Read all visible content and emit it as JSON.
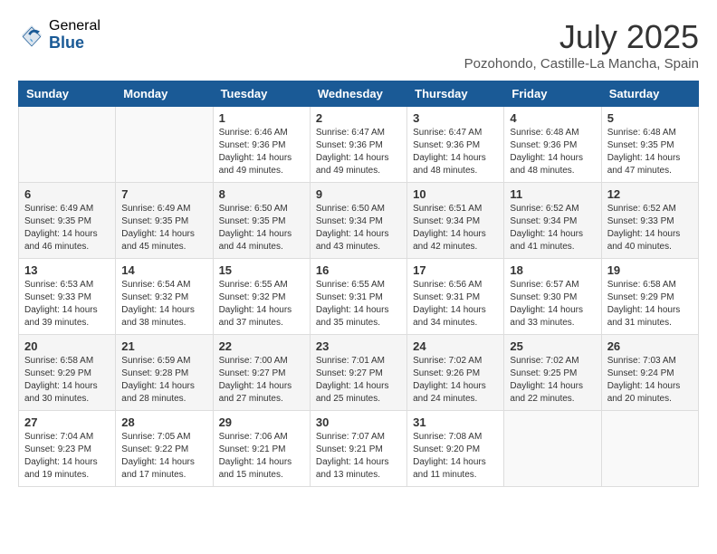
{
  "header": {
    "logo_general": "General",
    "logo_blue": "Blue",
    "month_title": "July 2025",
    "location": "Pozohondo, Castille-La Mancha, Spain"
  },
  "weekdays": [
    "Sunday",
    "Monday",
    "Tuesday",
    "Wednesday",
    "Thursday",
    "Friday",
    "Saturday"
  ],
  "weeks": [
    [
      {
        "day": "",
        "sunrise": "",
        "sunset": "",
        "daylight": ""
      },
      {
        "day": "",
        "sunrise": "",
        "sunset": "",
        "daylight": ""
      },
      {
        "day": "1",
        "sunrise": "Sunrise: 6:46 AM",
        "sunset": "Sunset: 9:36 PM",
        "daylight": "Daylight: 14 hours and 49 minutes."
      },
      {
        "day": "2",
        "sunrise": "Sunrise: 6:47 AM",
        "sunset": "Sunset: 9:36 PM",
        "daylight": "Daylight: 14 hours and 49 minutes."
      },
      {
        "day": "3",
        "sunrise": "Sunrise: 6:47 AM",
        "sunset": "Sunset: 9:36 PM",
        "daylight": "Daylight: 14 hours and 48 minutes."
      },
      {
        "day": "4",
        "sunrise": "Sunrise: 6:48 AM",
        "sunset": "Sunset: 9:36 PM",
        "daylight": "Daylight: 14 hours and 48 minutes."
      },
      {
        "day": "5",
        "sunrise": "Sunrise: 6:48 AM",
        "sunset": "Sunset: 9:35 PM",
        "daylight": "Daylight: 14 hours and 47 minutes."
      }
    ],
    [
      {
        "day": "6",
        "sunrise": "Sunrise: 6:49 AM",
        "sunset": "Sunset: 9:35 PM",
        "daylight": "Daylight: 14 hours and 46 minutes."
      },
      {
        "day": "7",
        "sunrise": "Sunrise: 6:49 AM",
        "sunset": "Sunset: 9:35 PM",
        "daylight": "Daylight: 14 hours and 45 minutes."
      },
      {
        "day": "8",
        "sunrise": "Sunrise: 6:50 AM",
        "sunset": "Sunset: 9:35 PM",
        "daylight": "Daylight: 14 hours and 44 minutes."
      },
      {
        "day": "9",
        "sunrise": "Sunrise: 6:50 AM",
        "sunset": "Sunset: 9:34 PM",
        "daylight": "Daylight: 14 hours and 43 minutes."
      },
      {
        "day": "10",
        "sunrise": "Sunrise: 6:51 AM",
        "sunset": "Sunset: 9:34 PM",
        "daylight": "Daylight: 14 hours and 42 minutes."
      },
      {
        "day": "11",
        "sunrise": "Sunrise: 6:52 AM",
        "sunset": "Sunset: 9:34 PM",
        "daylight": "Daylight: 14 hours and 41 minutes."
      },
      {
        "day": "12",
        "sunrise": "Sunrise: 6:52 AM",
        "sunset": "Sunset: 9:33 PM",
        "daylight": "Daylight: 14 hours and 40 minutes."
      }
    ],
    [
      {
        "day": "13",
        "sunrise": "Sunrise: 6:53 AM",
        "sunset": "Sunset: 9:33 PM",
        "daylight": "Daylight: 14 hours and 39 minutes."
      },
      {
        "day": "14",
        "sunrise": "Sunrise: 6:54 AM",
        "sunset": "Sunset: 9:32 PM",
        "daylight": "Daylight: 14 hours and 38 minutes."
      },
      {
        "day": "15",
        "sunrise": "Sunrise: 6:55 AM",
        "sunset": "Sunset: 9:32 PM",
        "daylight": "Daylight: 14 hours and 37 minutes."
      },
      {
        "day": "16",
        "sunrise": "Sunrise: 6:55 AM",
        "sunset": "Sunset: 9:31 PM",
        "daylight": "Daylight: 14 hours and 35 minutes."
      },
      {
        "day": "17",
        "sunrise": "Sunrise: 6:56 AM",
        "sunset": "Sunset: 9:31 PM",
        "daylight": "Daylight: 14 hours and 34 minutes."
      },
      {
        "day": "18",
        "sunrise": "Sunrise: 6:57 AM",
        "sunset": "Sunset: 9:30 PM",
        "daylight": "Daylight: 14 hours and 33 minutes."
      },
      {
        "day": "19",
        "sunrise": "Sunrise: 6:58 AM",
        "sunset": "Sunset: 9:29 PM",
        "daylight": "Daylight: 14 hours and 31 minutes."
      }
    ],
    [
      {
        "day": "20",
        "sunrise": "Sunrise: 6:58 AM",
        "sunset": "Sunset: 9:29 PM",
        "daylight": "Daylight: 14 hours and 30 minutes."
      },
      {
        "day": "21",
        "sunrise": "Sunrise: 6:59 AM",
        "sunset": "Sunset: 9:28 PM",
        "daylight": "Daylight: 14 hours and 28 minutes."
      },
      {
        "day": "22",
        "sunrise": "Sunrise: 7:00 AM",
        "sunset": "Sunset: 9:27 PM",
        "daylight": "Daylight: 14 hours and 27 minutes."
      },
      {
        "day": "23",
        "sunrise": "Sunrise: 7:01 AM",
        "sunset": "Sunset: 9:27 PM",
        "daylight": "Daylight: 14 hours and 25 minutes."
      },
      {
        "day": "24",
        "sunrise": "Sunrise: 7:02 AM",
        "sunset": "Sunset: 9:26 PM",
        "daylight": "Daylight: 14 hours and 24 minutes."
      },
      {
        "day": "25",
        "sunrise": "Sunrise: 7:02 AM",
        "sunset": "Sunset: 9:25 PM",
        "daylight": "Daylight: 14 hours and 22 minutes."
      },
      {
        "day": "26",
        "sunrise": "Sunrise: 7:03 AM",
        "sunset": "Sunset: 9:24 PM",
        "daylight": "Daylight: 14 hours and 20 minutes."
      }
    ],
    [
      {
        "day": "27",
        "sunrise": "Sunrise: 7:04 AM",
        "sunset": "Sunset: 9:23 PM",
        "daylight": "Daylight: 14 hours and 19 minutes."
      },
      {
        "day": "28",
        "sunrise": "Sunrise: 7:05 AM",
        "sunset": "Sunset: 9:22 PM",
        "daylight": "Daylight: 14 hours and 17 minutes."
      },
      {
        "day": "29",
        "sunrise": "Sunrise: 7:06 AM",
        "sunset": "Sunset: 9:21 PM",
        "daylight": "Daylight: 14 hours and 15 minutes."
      },
      {
        "day": "30",
        "sunrise": "Sunrise: 7:07 AM",
        "sunset": "Sunset: 9:21 PM",
        "daylight": "Daylight: 14 hours and 13 minutes."
      },
      {
        "day": "31",
        "sunrise": "Sunrise: 7:08 AM",
        "sunset": "Sunset: 9:20 PM",
        "daylight": "Daylight: 14 hours and 11 minutes."
      },
      {
        "day": "",
        "sunrise": "",
        "sunset": "",
        "daylight": ""
      },
      {
        "day": "",
        "sunrise": "",
        "sunset": "",
        "daylight": ""
      }
    ]
  ]
}
